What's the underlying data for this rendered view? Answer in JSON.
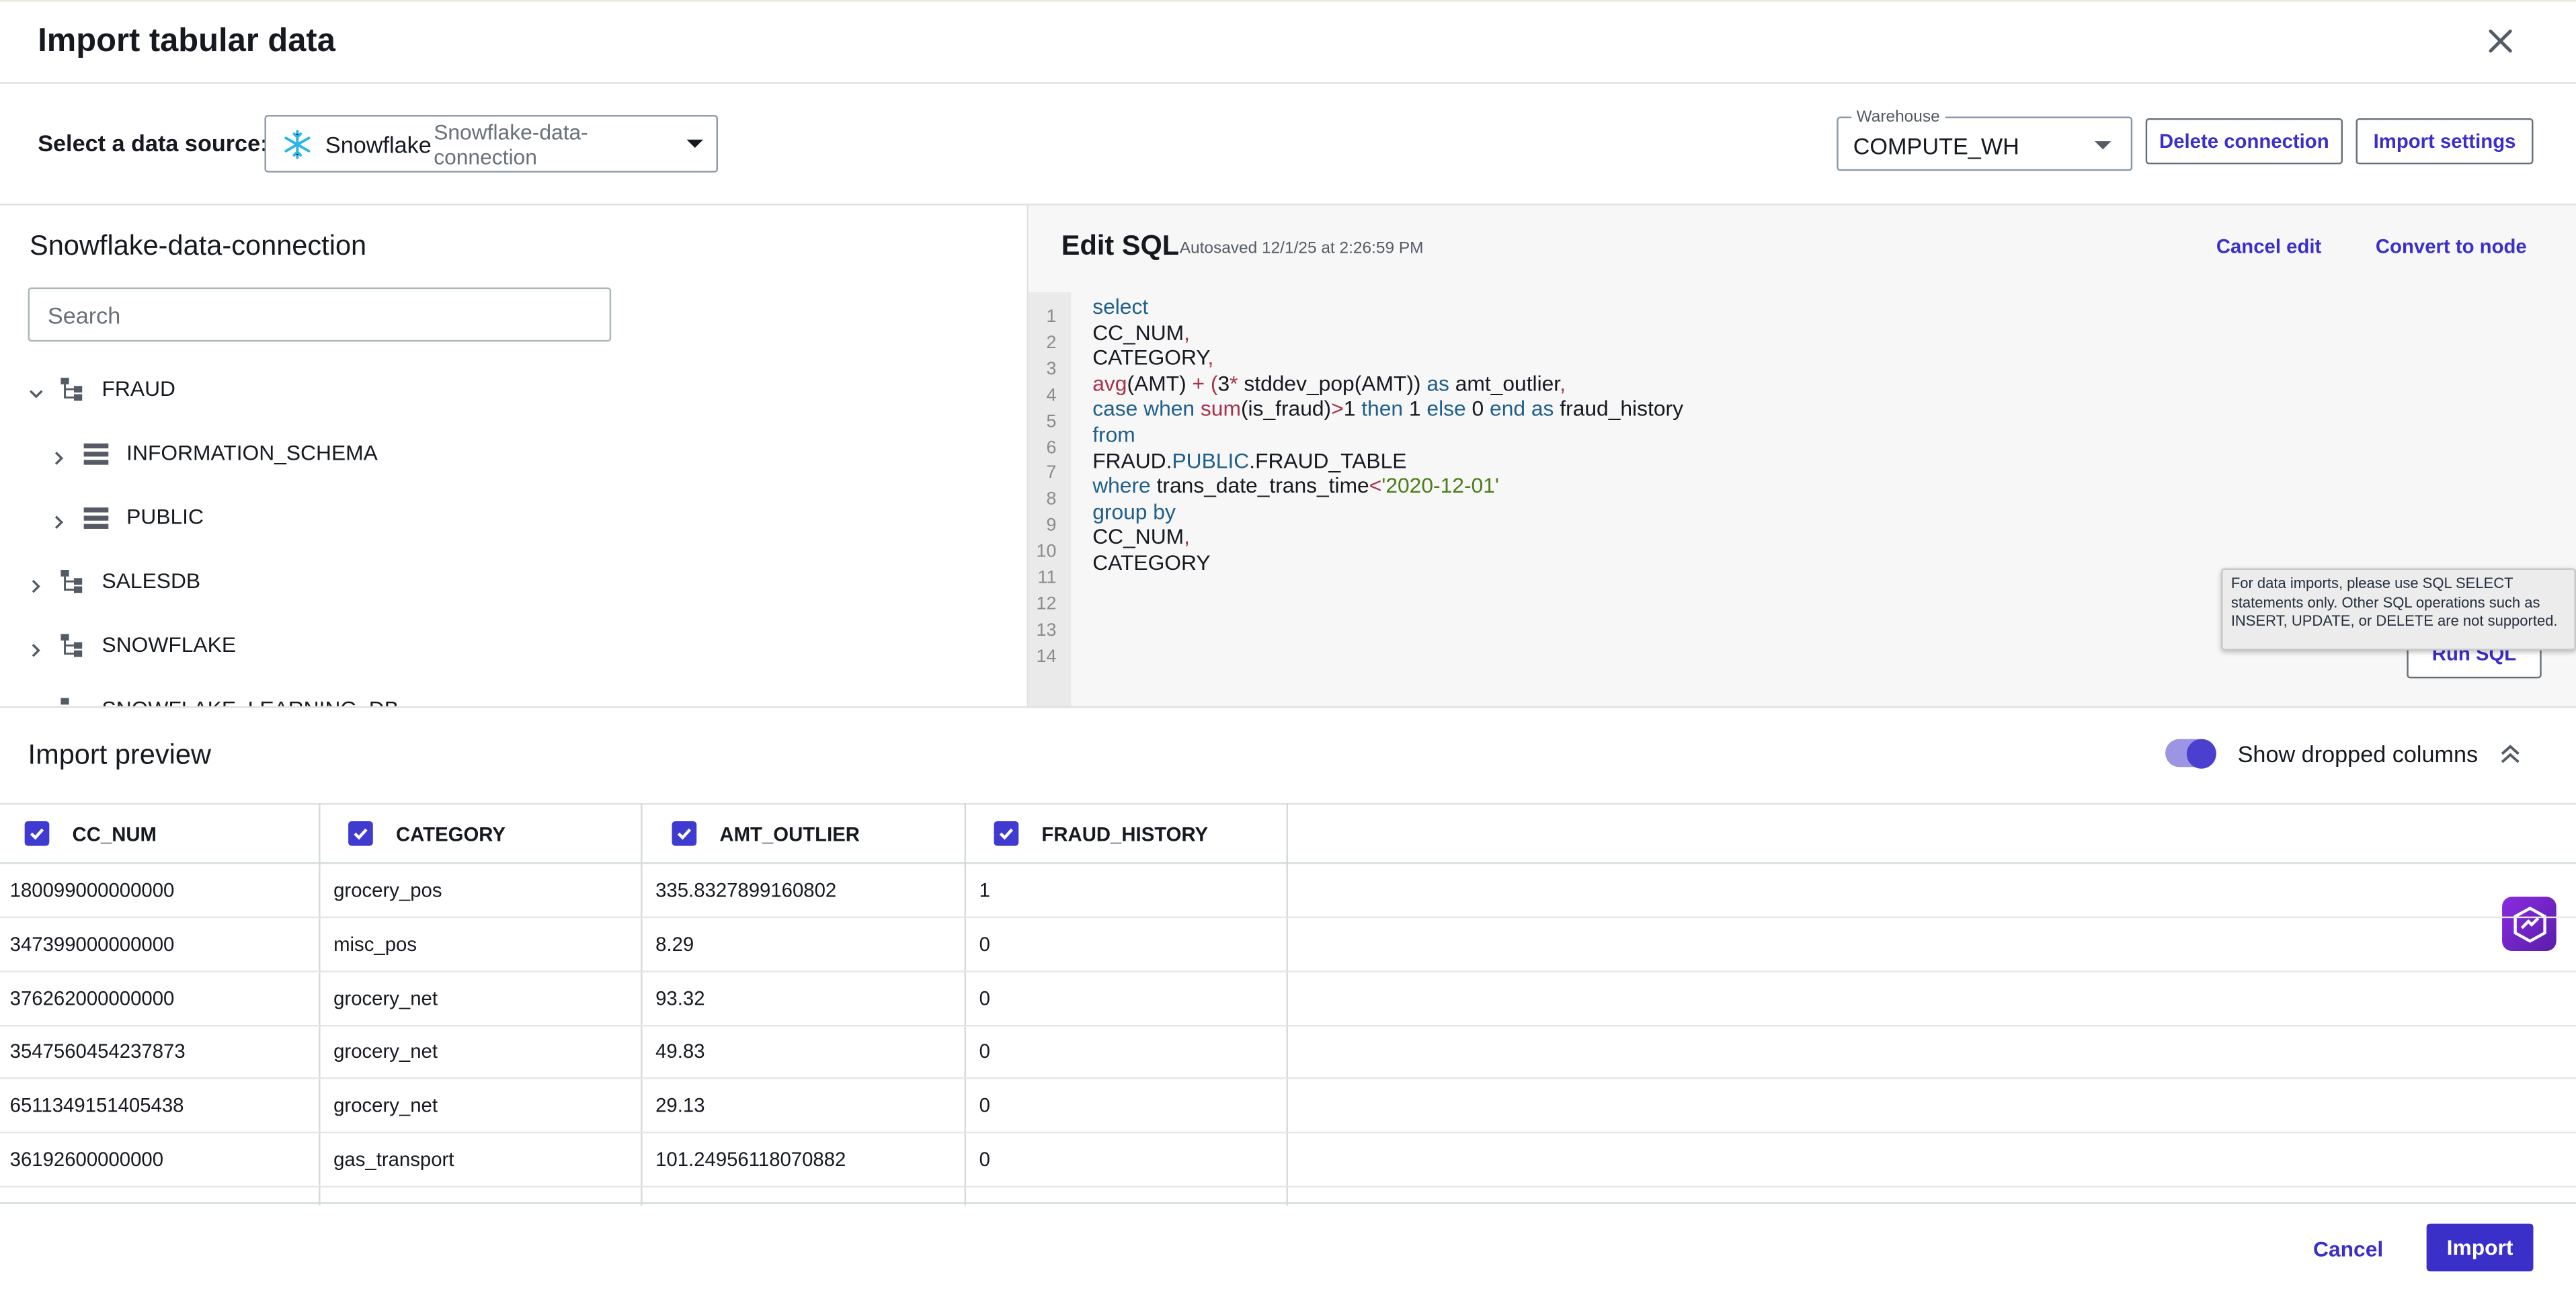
{
  "dialog": {
    "title": "Import tabular data"
  },
  "source": {
    "label": "Select a data source:",
    "selected_name": "Snowflake",
    "selected_connection": "Snowflake-data-connection"
  },
  "warehouse": {
    "label": "Warehouse",
    "value": "COMPUTE_WH"
  },
  "buttons": {
    "delete_connection": "Delete connection",
    "import_settings": "Import settings",
    "cancel_edit": "Cancel edit",
    "convert_to_node": "Convert to node",
    "run_sql": "Run SQL",
    "cancel": "Cancel",
    "import": "Import"
  },
  "browser": {
    "title": "Snowflake-data-connection",
    "search_placeholder": "Search",
    "tree": [
      {
        "label": "FRAUD",
        "expanded": true,
        "type": "database"
      },
      {
        "label": "INFORMATION_SCHEMA",
        "type": "schema"
      },
      {
        "label": "PUBLIC",
        "type": "schema"
      },
      {
        "label": "SALESDB",
        "type": "database"
      },
      {
        "label": "SNOWFLAKE",
        "type": "database"
      },
      {
        "label": "SNOWFLAKE_LEARNING_DB",
        "type": "database"
      }
    ]
  },
  "editor": {
    "title": "Edit SQL",
    "autosaved": "Autosaved 12/1/25 at 2:26:59 PM",
    "line_numbers": [
      "1",
      "2",
      "3",
      "4",
      "5",
      "6",
      "7",
      "8",
      "9",
      "10",
      "11",
      "12",
      "13",
      "14"
    ],
    "code": [
      [
        {
          "t": "select",
          "c": "kw"
        }
      ],
      [
        {
          "t": "CC_NUM",
          "c": ""
        },
        {
          "t": ",",
          "c": "fn"
        }
      ],
      [
        {
          "t": "CATEGORY",
          "c": ""
        },
        {
          "t": ",",
          "c": "fn"
        }
      ],
      [
        {
          "t": "avg",
          "c": "fn"
        },
        {
          "t": "(AMT) ",
          "c": ""
        },
        {
          "t": "+ (",
          "c": "fn"
        },
        {
          "t": "3",
          "c": ""
        },
        {
          "t": "* ",
          "c": "fn"
        },
        {
          "t": "stddev_pop",
          "c": ""
        },
        {
          "t": "(AMT)) ",
          "c": ""
        },
        {
          "t": "as ",
          "c": "kw"
        },
        {
          "t": "amt_outlier",
          "c": ""
        },
        {
          "t": ",",
          "c": "fn"
        }
      ],
      [
        {
          "t": "case when ",
          "c": "kw"
        },
        {
          "t": "sum",
          "c": "fn"
        },
        {
          "t": "(is_fraud)",
          "c": ""
        },
        {
          "t": ">",
          "c": "fn"
        },
        {
          "t": "1 ",
          "c": ""
        },
        {
          "t": "then ",
          "c": "kw"
        },
        {
          "t": "1 ",
          "c": ""
        },
        {
          "t": "else ",
          "c": "kw"
        },
        {
          "t": "0 ",
          "c": ""
        },
        {
          "t": "end as ",
          "c": "kw"
        },
        {
          "t": "fraud_history",
          "c": ""
        }
      ],
      [
        {
          "t": "from",
          "c": "kw"
        }
      ],
      [
        {
          "t": "FRAUD.",
          "c": ""
        },
        {
          "t": "PUBLIC",
          "c": "kw"
        },
        {
          "t": ".FRAUD_TABLE",
          "c": ""
        }
      ],
      [
        {
          "t": "where ",
          "c": "kw"
        },
        {
          "t": "trans_date_trans_time",
          "c": ""
        },
        {
          "t": "<",
          "c": "fn"
        },
        {
          "t": "'2020-12-01'",
          "c": "str"
        }
      ],
      [
        {
          "t": "group by",
          "c": "kw"
        }
      ],
      [
        {
          "t": "CC_NUM",
          "c": ""
        },
        {
          "t": ",",
          "c": "fn"
        }
      ],
      [
        {
          "t": "CATEGORY",
          "c": ""
        }
      ]
    ],
    "tooltip": "For data imports, please use SQL SELECT statements only. Other SQL operations such as INSERT, UPDATE, or DELETE are not supported."
  },
  "preview": {
    "title": "Import preview",
    "show_dropped_label": "Show dropped columns",
    "show_dropped_on": true,
    "columns": [
      "CC_NUM",
      "CATEGORY",
      "AMT_OUTLIER",
      "FRAUD_HISTORY"
    ],
    "rows": [
      [
        "180099000000000",
        "grocery_pos",
        "335.8327899160802",
        "1"
      ],
      [
        "347399000000000",
        "misc_pos",
        "8.29",
        "0"
      ],
      [
        "376262000000000",
        "grocery_net",
        "93.32",
        "0"
      ],
      [
        "3547560454237873",
        "grocery_net",
        "49.83",
        "0"
      ],
      [
        "6511349151405438",
        "grocery_net",
        "29.13",
        "0"
      ],
      [
        "36192600000000",
        "gas_transport",
        "101.24956118070882",
        "0"
      ]
    ]
  },
  "colors": {
    "accent": "#3b2fc9"
  }
}
